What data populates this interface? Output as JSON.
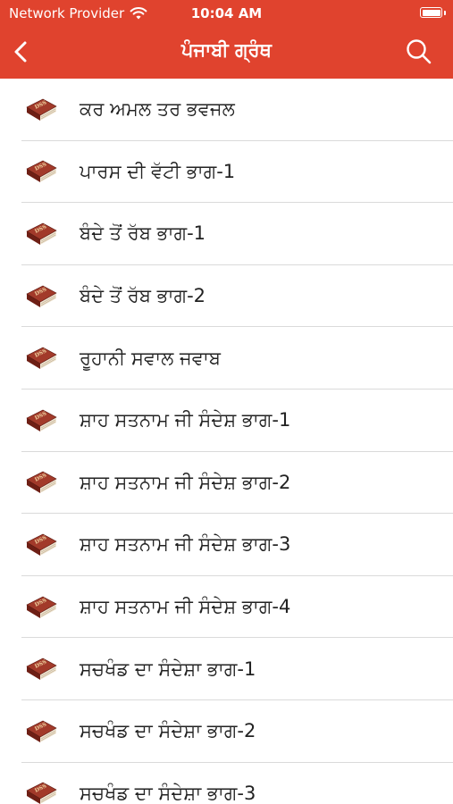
{
  "status_bar": {
    "carrier": "Network Provider",
    "time": "10:04 AM",
    "wifi_icon": "wifi-icon",
    "battery_icon": "battery-icon"
  },
  "nav": {
    "title": "ਪੰਜਾਬੀ ਗ੍ਰੰਥ",
    "back_icon": "chevron-left-icon",
    "search_icon": "search-icon"
  },
  "colors": {
    "header_background": "#e0432e",
    "header_text": "#ffffff",
    "book_cover": "#8b2a1e",
    "divider": "#dadada"
  },
  "books": [
    {
      "title": "ਕਰ ਅਮਲ ਤਰ ਭਵਜਲ",
      "icon": "book-icon",
      "icon_label": "DSS"
    },
    {
      "title": "ਪਾਰਸ ਦੀ ਵੱਟੀ ਭਾਗ-1",
      "icon": "book-icon",
      "icon_label": "DSS"
    },
    {
      "title": "ਬੰਦੇ ਤੋਂ ਰੱਬ ਭਾਗ-1",
      "icon": "book-icon",
      "icon_label": "DSS"
    },
    {
      "title": "ਬੰਦੇ ਤੋਂ ਰੱਬ ਭਾਗ-2",
      "icon": "book-icon",
      "icon_label": "DSS"
    },
    {
      "title": "ਰੂਹਾਨੀ ਸਵਾਲ ਜਵਾਬ",
      "icon": "book-icon",
      "icon_label": "DSS"
    },
    {
      "title": "ਸ਼ਾਹ ਸਤਨਾਮ ਜੀ ਸੰਦੇਸ਼ ਭਾਗ-1",
      "icon": "book-icon",
      "icon_label": "DSS"
    },
    {
      "title": "ਸ਼ਾਹ ਸਤਨਾਮ ਜੀ ਸੰਦੇਸ਼ ਭਾਗ-2",
      "icon": "book-icon",
      "icon_label": "DSS"
    },
    {
      "title": "ਸ਼ਾਹ ਸਤਨਾਮ ਜੀ ਸੰਦੇਸ਼ ਭਾਗ-3",
      "icon": "book-icon",
      "icon_label": "DSS"
    },
    {
      "title": "ਸ਼ਾਹ ਸਤਨਾਮ ਜੀ ਸੰਦੇਸ਼ ਭਾਗ-4",
      "icon": "book-icon",
      "icon_label": "DSS"
    },
    {
      "title": "ਸਚਖੰਡ ਦਾ ਸੰਦੇਸ਼ਾ ਭਾਗ-1",
      "icon": "book-icon",
      "icon_label": "DSS"
    },
    {
      "title": "ਸਚਖੰਡ ਦਾ ਸੰਦੇਸ਼ਾ ਭਾਗ-2",
      "icon": "book-icon",
      "icon_label": "DSS"
    },
    {
      "title": "ਸਚਖੰਡ ਦਾ ਸੰਦੇਸ਼ਾ ਭਾਗ-3",
      "icon": "book-icon",
      "icon_label": "DSS"
    }
  ]
}
